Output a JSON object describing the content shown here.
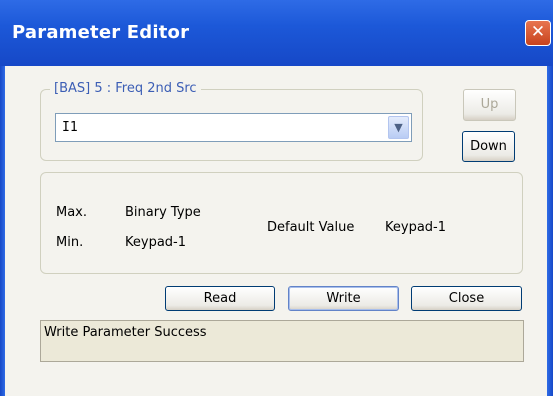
{
  "window": {
    "title": "Parameter Editor",
    "close_glyph": "✕"
  },
  "group": {
    "legend": "[BAS] 5 : Freq 2nd Src"
  },
  "combo": {
    "value": "I1",
    "arrow": "▼"
  },
  "buttons": {
    "up": "Up",
    "down": "Down",
    "read": "Read",
    "write": "Write",
    "close": "Close"
  },
  "info": {
    "max_label": "Max.",
    "max_value": "Binary Type",
    "min_label": "Min.",
    "min_value": "Keypad-1",
    "default_label": "Default Value",
    "default_value": "Keypad-1"
  },
  "status": {
    "message": "Write Parameter Success"
  },
  "colors": {
    "titlebar": "#1C58D8",
    "legend_text": "#3C5EB5",
    "face": "#F4F3EE",
    "close_red": "#C8431D"
  }
}
